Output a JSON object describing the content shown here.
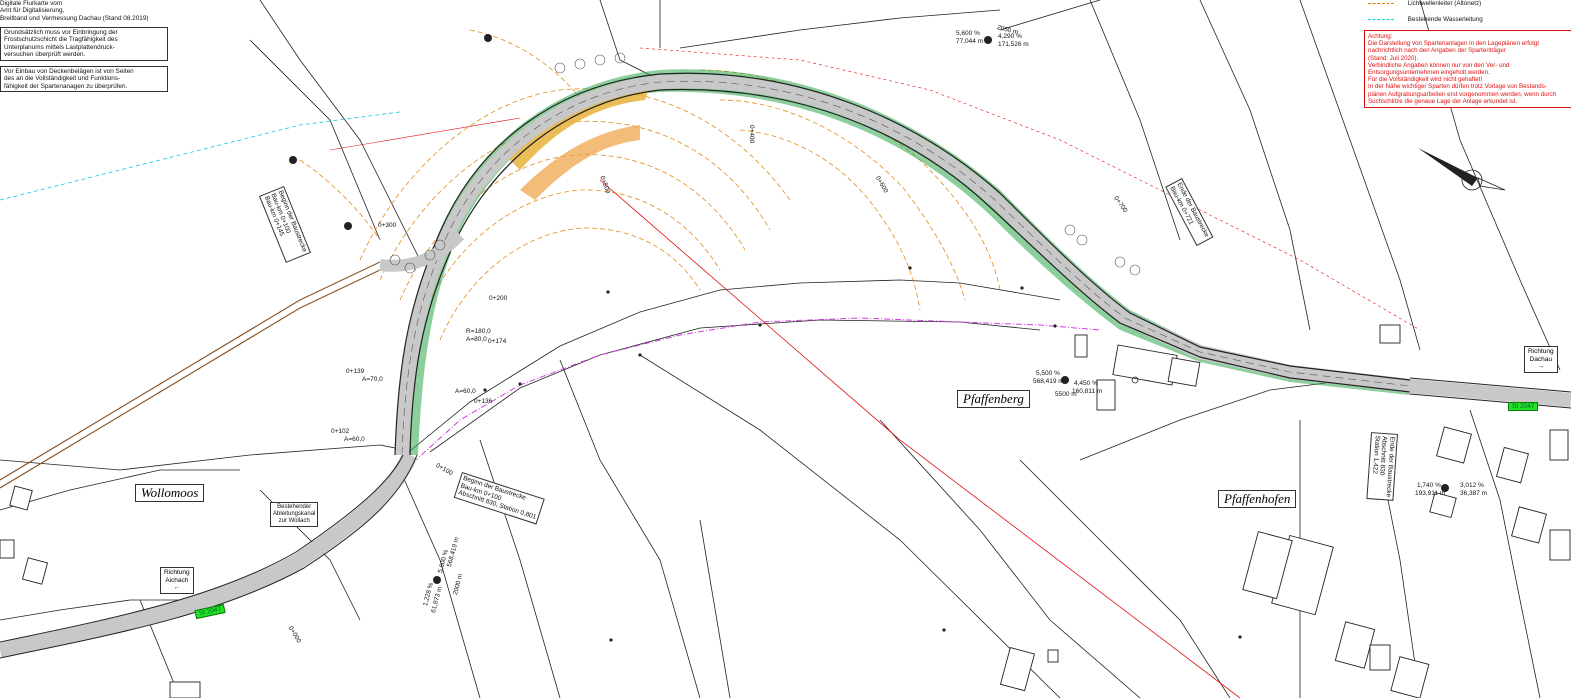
{
  "header_notes": {
    "source_lines": [
      "Digitale Flurkarte vom",
      "Amt für Digitalisierung,",
      "Breitband und Vermessung Dachau (Stand 08.2019)"
    ],
    "frost_note": [
      "Grundsätzlich muss vor Einbringung der",
      "Frostschutzschicht die Tragfähigkeit des",
      "Unterplanums mittels Lastplattendruck-",
      "versuchen überprüft werden."
    ],
    "ceiling_note": [
      "Vor Einbau von Deckenbelägen ist von Seiten",
      "des an die Vollständigkeit und Funktions-",
      "fähigkeit der Spartenanagen zu überprüfen."
    ]
  },
  "legend": {
    "items": [
      {
        "label": "Lichtwellenleiter (Altonetz)",
        "color": "#e07a00"
      },
      {
        "label": "Bestehende Wasserleitung",
        "color": "#10c8e8"
      }
    ]
  },
  "warning": {
    "title": "Achtung:",
    "lines": [
      "Die Darstellung von Spartenanlagen in den Lageplänen erfolgt",
      "nachrichtlich nach den Angaben der Spartenträger",
      "(Stand: Juli 2020).",
      "Verbindliche Angaben können nur von den Ver- und",
      "Entsorgungsunternehmen eingeholt werden.",
      "Für die Vollständigkeit wird nicht gehaftet!",
      "In der Nähe wichtiger Sparten dürfen trotz Vorlage von Bestands-",
      "plänen Aufgrabungsarbeiten erst vorgenommen werden, wenn durch",
      "Suchschlitze die genaue Lage der Anlage erkundet ist."
    ],
    "color": "#e01010"
  },
  "places": {
    "wollomoos": "Wollomoos",
    "pfaffenberg": "Pfaffenberg",
    "pfaffenhofen": "Pfaffenhofen"
  },
  "road_labels": {
    "st_left": "St 2047",
    "st_right": "St 2047"
  },
  "directions": {
    "aichach": [
      "Richtung",
      "Aichach"
    ],
    "dachau": [
      "Richtung",
      "Dachau"
    ]
  },
  "annotations": {
    "drain_box": [
      "Bestehender",
      "Ableitungskanal",
      "zur Wollach"
    ],
    "start_bau": [
      "Beginn der Baustrecke",
      "Bau-km 0+100",
      "Abschnitt 830, Station 0,801"
    ],
    "start_bau_left": [
      "Beginn der Baustrecke",
      "Bau-km 0+100",
      "Bau-km 0+145"
    ],
    "end_bau": [
      "Ende der Baustrecke",
      "Bau-km 0+721"
    ],
    "end_bau_right": [
      "Ende der Baustrecke",
      "Abschnitt 830",
      "Station 1,422"
    ],
    "stations": [
      "0+300",
      "0+200",
      "0+400",
      "0+500",
      "0+600",
      "0+700",
      "0+139",
      "0+102",
      "0+100",
      "0+000"
    ],
    "curve_params": [
      "R=180,0",
      "A=80,0",
      "0+174",
      "A=70,0",
      "A=60,0",
      "0+136",
      "A=60,0"
    ],
    "slopes": [
      {
        "a": "5,600 %",
        "b": "77,044 m",
        "c": "2050 m",
        "d": "4,290 %",
        "e": "171,526 m"
      },
      {
        "a": "5,500 %",
        "b": "568,419 m",
        "c": "5500 m",
        "d": "4,450 %",
        "e": "160,811 m"
      },
      {
        "a": "1,740 %",
        "b": "193,911 m",
        "c": "3,012 %",
        "d": "36,387 m"
      },
      {
        "a": "1,228 %",
        "b": "61,973 m",
        "c": "2000 m",
        "d": "5,600 %",
        "e": "568,419 m"
      }
    ]
  },
  "colors": {
    "road_fill": "#d6d6d6",
    "green_strip": "#2fa74a",
    "embankment": "#e8b23a",
    "property_line": "#222222",
    "contour": "#e08c1c",
    "magenta_line": "#d040e0",
    "red_line": "#e01010"
  }
}
